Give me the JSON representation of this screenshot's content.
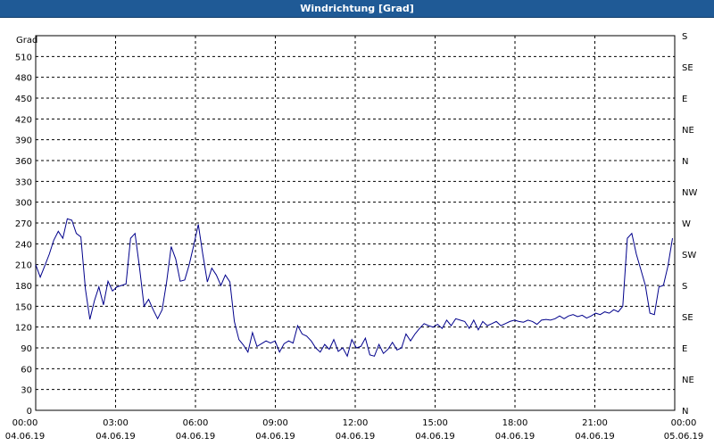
{
  "window": {
    "title": "Windrichtung [Grad]"
  },
  "colors": {
    "titlebar": "#1f5a96",
    "series": "#00008b",
    "grid": "#000000",
    "background": "#ffffff"
  },
  "chart_data": {
    "type": "line",
    "title": "Windrichtung [Grad]",
    "ylabel": "Grad",
    "ylim": [
      0,
      540
    ],
    "xlim": [
      0,
      24
    ],
    "grid": true,
    "y_ticks": [
      0,
      30,
      60,
      90,
      120,
      150,
      180,
      210,
      240,
      270,
      300,
      330,
      360,
      390,
      420,
      450,
      480,
      510
    ],
    "y2_ticks": [
      {
        "value": 0,
        "label": "N"
      },
      {
        "value": 45,
        "label": "NE"
      },
      {
        "value": 90,
        "label": "E"
      },
      {
        "value": 135,
        "label": "SE"
      },
      {
        "value": 180,
        "label": "S"
      },
      {
        "value": 225,
        "label": "SW"
      },
      {
        "value": 270,
        "label": "W"
      },
      {
        "value": 315,
        "label": "NW"
      },
      {
        "value": 360,
        "label": "N"
      },
      {
        "value": 405,
        "label": "NE"
      },
      {
        "value": 450,
        "label": "E"
      },
      {
        "value": 495,
        "label": "SE"
      },
      {
        "value": 540,
        "label": "S"
      }
    ],
    "x_ticks": [
      {
        "value": 0,
        "time": "00:00",
        "date": "04.06.19"
      },
      {
        "value": 3,
        "time": "03:00",
        "date": "04.06.19"
      },
      {
        "value": 6,
        "time": "06:00",
        "date": "04.06.19"
      },
      {
        "value": 9,
        "time": "09:00",
        "date": "04.06.19"
      },
      {
        "value": 12,
        "time": "12:00",
        "date": "04.06.19"
      },
      {
        "value": 15,
        "time": "15:00",
        "date": "04.06.19"
      },
      {
        "value": 18,
        "time": "18:00",
        "date": "04.06.19"
      },
      {
        "value": 21,
        "time": "21:00",
        "date": "04.06.19"
      },
      {
        "value": 24,
        "time": "00:00",
        "date": "05.06.19"
      }
    ],
    "series": [
      {
        "values": [
          [
            0.0,
            210
          ],
          [
            0.2,
            192
          ],
          [
            0.4,
            208
          ],
          [
            0.6,
            225
          ],
          [
            0.8,
            245
          ],
          [
            1.0,
            258
          ],
          [
            1.2,
            248
          ],
          [
            1.4,
            276
          ],
          [
            1.6,
            274
          ],
          [
            1.8,
            255
          ],
          [
            2.0,
            250
          ],
          [
            2.2,
            175
          ],
          [
            2.4,
            131
          ],
          [
            2.6,
            158
          ],
          [
            2.8,
            178
          ],
          [
            3.0,
            152
          ],
          [
            3.2,
            186
          ],
          [
            3.4,
            172
          ],
          [
            3.6,
            178
          ],
          [
            3.8,
            180
          ],
          [
            4.0,
            182
          ],
          [
            4.2,
            248
          ],
          [
            4.4,
            255
          ],
          [
            4.6,
            205
          ],
          [
            4.8,
            150
          ],
          [
            5.0,
            160
          ],
          [
            5.2,
            145
          ],
          [
            5.4,
            132
          ],
          [
            5.6,
            145
          ],
          [
            5.8,
            185
          ],
          [
            6.0,
            236
          ],
          [
            6.2,
            218
          ],
          [
            6.4,
            186
          ],
          [
            6.6,
            188
          ],
          [
            6.8,
            210
          ],
          [
            7.0,
            238
          ],
          [
            7.2,
            268
          ],
          [
            7.4,
            225
          ],
          [
            7.6,
            185
          ],
          [
            7.8,
            205
          ],
          [
            8.0,
            195
          ],
          [
            8.2,
            180
          ],
          [
            8.4,
            195
          ],
          [
            8.6,
            185
          ],
          [
            8.8,
            128
          ],
          [
            9.0,
            102
          ],
          [
            9.2,
            94
          ],
          [
            9.4,
            84
          ],
          [
            9.6,
            112
          ],
          [
            9.8,
            92
          ],
          [
            10.0,
            96
          ],
          [
            10.2,
            100
          ],
          [
            10.4,
            97
          ],
          [
            10.6,
            100
          ],
          [
            10.8,
            84
          ],
          [
            11.0,
            96
          ],
          [
            11.2,
            100
          ],
          [
            11.4,
            97
          ],
          [
            11.6,
            122
          ],
          [
            11.8,
            110
          ],
          [
            12.0,
            107
          ],
          [
            12.2,
            100
          ],
          [
            12.4,
            90
          ],
          [
            12.6,
            84
          ],
          [
            12.8,
            95
          ],
          [
            13.0,
            88
          ],
          [
            13.2,
            102
          ],
          [
            13.4,
            85
          ],
          [
            13.6,
            90
          ],
          [
            13.8,
            78
          ],
          [
            14.0,
            102
          ],
          [
            14.2,
            90
          ],
          [
            14.4,
            92
          ],
          [
            14.6,
            104
          ],
          [
            14.8,
            80
          ],
          [
            15.0,
            78
          ],
          [
            15.2,
            95
          ],
          [
            15.4,
            82
          ],
          [
            15.6,
            88
          ],
          [
            15.8,
            98
          ],
          [
            16.0,
            87
          ],
          [
            16.2,
            90
          ],
          [
            16.4,
            110
          ],
          [
            16.6,
            100
          ],
          [
            16.8,
            110
          ],
          [
            17.0,
            118
          ],
          [
            17.2,
            125
          ],
          [
            17.4,
            122
          ],
          [
            17.6,
            120
          ],
          [
            17.8,
            124
          ],
          [
            18.0,
            118
          ],
          [
            18.2,
            130
          ],
          [
            18.4,
            122
          ],
          [
            18.6,
            132
          ],
          [
            18.8,
            130
          ],
          [
            19.0,
            128
          ],
          [
            19.2,
            118
          ],
          [
            19.4,
            130
          ],
          [
            19.6,
            116
          ],
          [
            19.8,
            128
          ],
          [
            20.0,
            122
          ],
          [
            20.2,
            125
          ],
          [
            20.4,
            128
          ],
          [
            20.6,
            122
          ],
          [
            20.8,
            125
          ],
          [
            21.0,
            128
          ],
          [
            21.2,
            130
          ],
          [
            21.4,
            128
          ],
          [
            21.6,
            127
          ],
          [
            21.8,
            130
          ],
          [
            22.0,
            128
          ],
          [
            22.2,
            124
          ],
          [
            22.4,
            130
          ],
          [
            22.6,
            131
          ],
          [
            22.8,
            130
          ],
          [
            23.0,
            132
          ],
          [
            23.2,
            136
          ],
          [
            23.4,
            132
          ],
          [
            23.6,
            136
          ],
          [
            23.8,
            138
          ],
          [
            24.0,
            135
          ],
          [
            24.2,
            137
          ],
          [
            24.4,
            133
          ],
          [
            24.6,
            136
          ],
          [
            24.8,
            140
          ],
          [
            25.0,
            138
          ],
          [
            25.2,
            142
          ],
          [
            25.4,
            140
          ],
          [
            25.6,
            145
          ],
          [
            25.8,
            142
          ],
          [
            26.0,
            150
          ],
          [
            26.2,
            248
          ],
          [
            26.4,
            255
          ],
          [
            26.6,
            225
          ],
          [
            26.8,
            203
          ],
          [
            27.0,
            180
          ],
          [
            27.2,
            140
          ],
          [
            27.4,
            138
          ],
          [
            27.6,
            178
          ],
          [
            27.8,
            180
          ],
          [
            28.0,
            208
          ],
          [
            28.2,
            248
          ]
        ]
      }
    ]
  }
}
